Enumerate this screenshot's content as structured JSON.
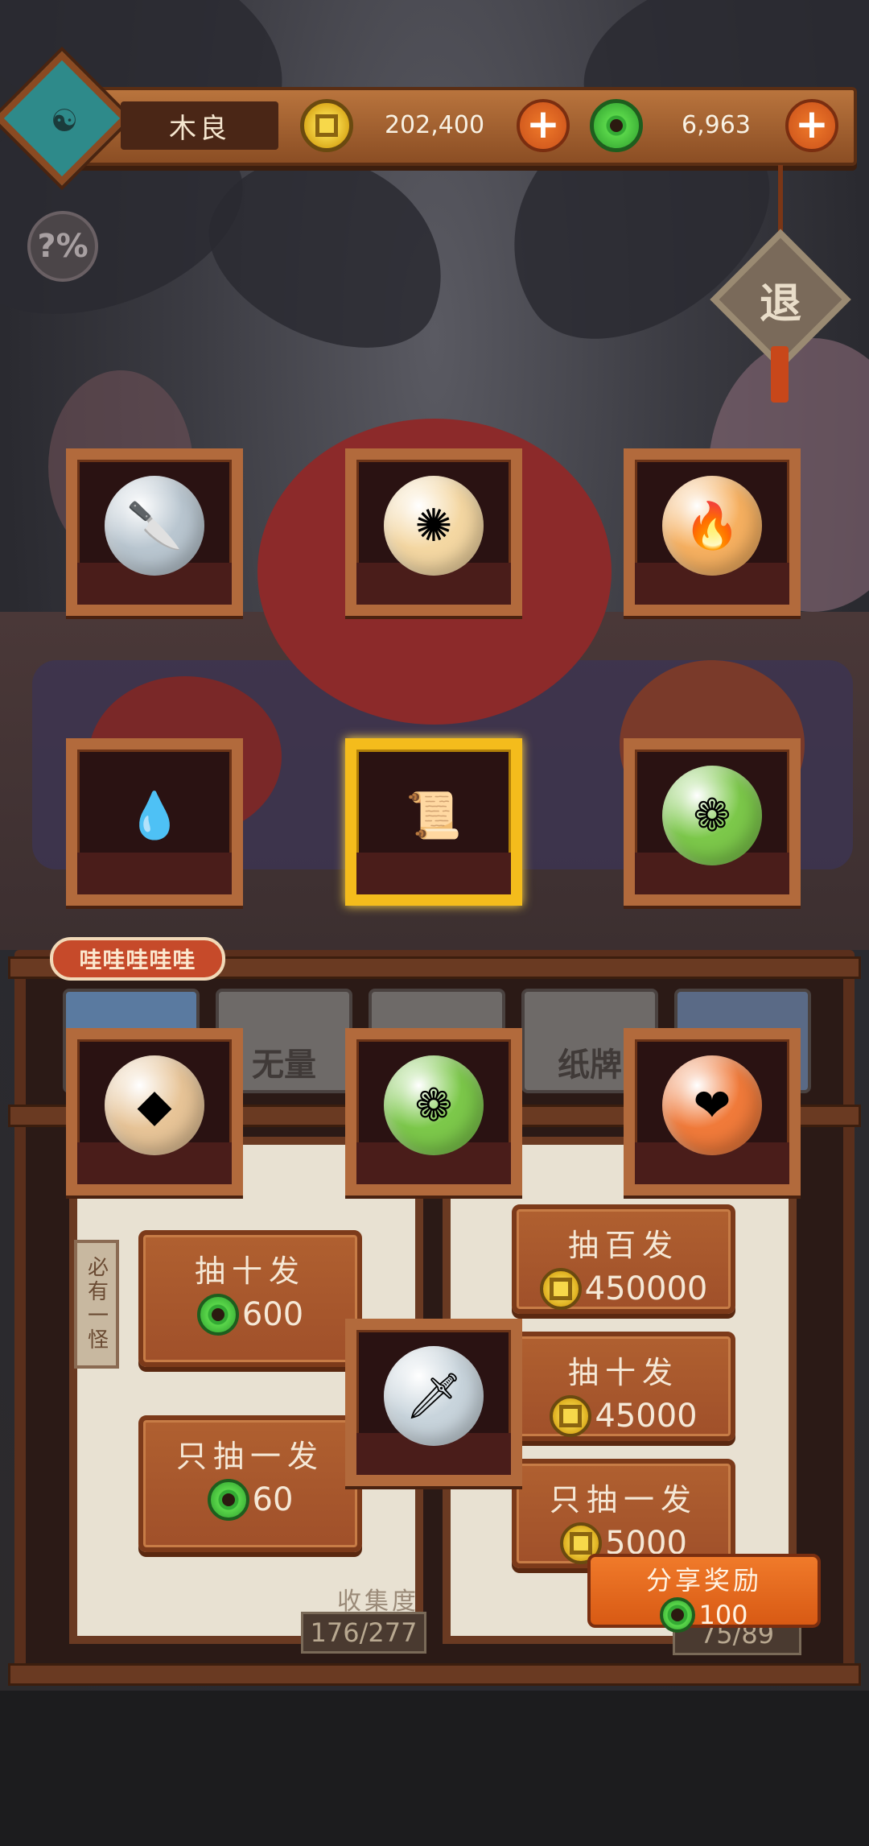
{
  "header": {
    "player_name": "木良",
    "gold_amount": "202,400",
    "jade_amount": "6,963",
    "probability_label": "?%",
    "exit_label": "退"
  },
  "items_grid": [
    {
      "id": "cleaver",
      "icon": "cleaver-orb-icon",
      "glyph": "🔪",
      "color": "#b9c6d0",
      "selected": false
    },
    {
      "id": "yellow-talisman",
      "icon": "gold-charm-orb-icon",
      "glyph": "✺",
      "color": "#f4d7a2",
      "selected": false
    },
    {
      "id": "fire",
      "icon": "fire-orb-icon",
      "glyph": "🔥",
      "color": "#f6b060",
      "selected": false
    },
    {
      "id": "blue-flame",
      "icon": "blue-flame-icon",
      "glyph": "💧",
      "color": "#2a1212",
      "selected": false
    },
    {
      "id": "scroll-baby",
      "icon": "scroll-baby-icon",
      "glyph": "📜",
      "color": "#2a1212",
      "selected": true
    },
    {
      "id": "green-pouch",
      "icon": "green-pouch-orb-icon",
      "glyph": "❁",
      "color": "#7cc84a",
      "selected": false
    },
    {
      "id": "red-gem",
      "icon": "red-gem-orb-icon",
      "glyph": "◆",
      "color": "#e7c497",
      "selected": false
    },
    {
      "id": "green-pouch-2",
      "icon": "green-pouch-orb-icon",
      "glyph": "❁",
      "color": "#7cc84a",
      "selected": false
    },
    {
      "id": "fire-heart",
      "icon": "fire-heart-orb-icon",
      "glyph": "❤",
      "color": "#f07a3a",
      "selected": false
    },
    {
      "id": "sword",
      "icon": "sword-orb-icon",
      "glyph": "🗡",
      "color": "#c8d4dc",
      "selected": false
    }
  ],
  "speech_bubble": "哇哇哇哇哇",
  "tabs": [
    {
      "label": ""
    },
    {
      "label": "无量"
    },
    {
      "label": ""
    },
    {
      "label": "纸牌"
    },
    {
      "label": ""
    }
  ],
  "side_tag": "必有一怪",
  "left_pool": {
    "draw_ten": {
      "label": "抽十发",
      "price": "600",
      "currency": "jade"
    },
    "draw_one": {
      "label": "只抽一发",
      "price": "60",
      "currency": "jade"
    }
  },
  "right_pool": {
    "draw_hundred": {
      "label": "抽百发",
      "price": "450000",
      "currency": "gold"
    },
    "draw_ten": {
      "label": "抽十发",
      "price": "45000",
      "currency": "gold"
    },
    "draw_one": {
      "label": "只抽一发",
      "price": "5000",
      "currency": "gold"
    }
  },
  "collection": {
    "label": "收集度",
    "left_count": "176/277",
    "right_count": "75/89"
  },
  "share": {
    "label": "分享奖励",
    "reward": "100"
  },
  "colors": {
    "gold": "#d9a819",
    "jade": "#2c9c2c",
    "accent_orange": "#d85a14",
    "frame_wood": "#b26a3c",
    "frame_selected": "#f4bc1c"
  }
}
